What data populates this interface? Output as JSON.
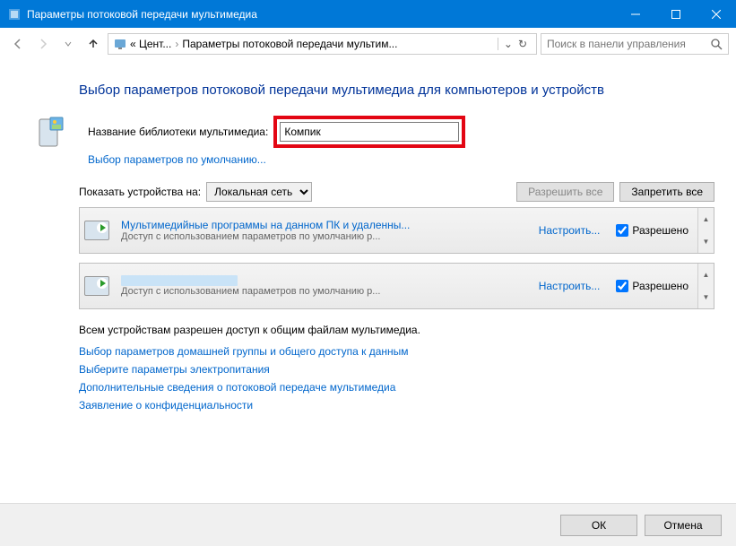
{
  "titlebar": {
    "title": "Параметры потоковой передачи мультимедиа"
  },
  "nav": {
    "breadcrumb_prefix": "« Цент...",
    "breadcrumb_current": "Параметры потоковой передачи мультим...",
    "search_placeholder": "Поиск в панели управления"
  },
  "main": {
    "heading": "Выбор параметров потоковой передачи мультимедиа для компьютеров и устройств",
    "libname_label": "Название библиотеки мультимедиа:",
    "libname_value": "Компик",
    "default_params_link": "Выбор параметров по умолчанию...",
    "show_label": "Показать устройства на:",
    "show_option": "Локальная сеть",
    "allow_all": "Разрешить все",
    "deny_all": "Запретить все",
    "devices": [
      {
        "name": "Мультимедийные программы на данном ПК и удаленны...",
        "desc": "Доступ с использованием параметров по умолчанию р...",
        "customize": "Настроить...",
        "check_label": "Разрешено",
        "checked": true
      },
      {
        "name": "",
        "desc": "Доступ с использованием параметров по умолчанию р...",
        "customize": "Настроить...",
        "check_label": "Разрешено",
        "checked": true,
        "redacted": true
      }
    ],
    "info_text": "Всем устройствам разрешен доступ к общим файлам мультимедиа.",
    "links": [
      "Выбор параметров домашней группы и общего доступа к данным",
      "Выберите параметры электропитания",
      "Дополнительные сведения о потоковой передаче мультимедиа",
      "Заявление о конфиденциальности"
    ]
  },
  "footer": {
    "ok": "ОК",
    "cancel": "Отмена"
  }
}
